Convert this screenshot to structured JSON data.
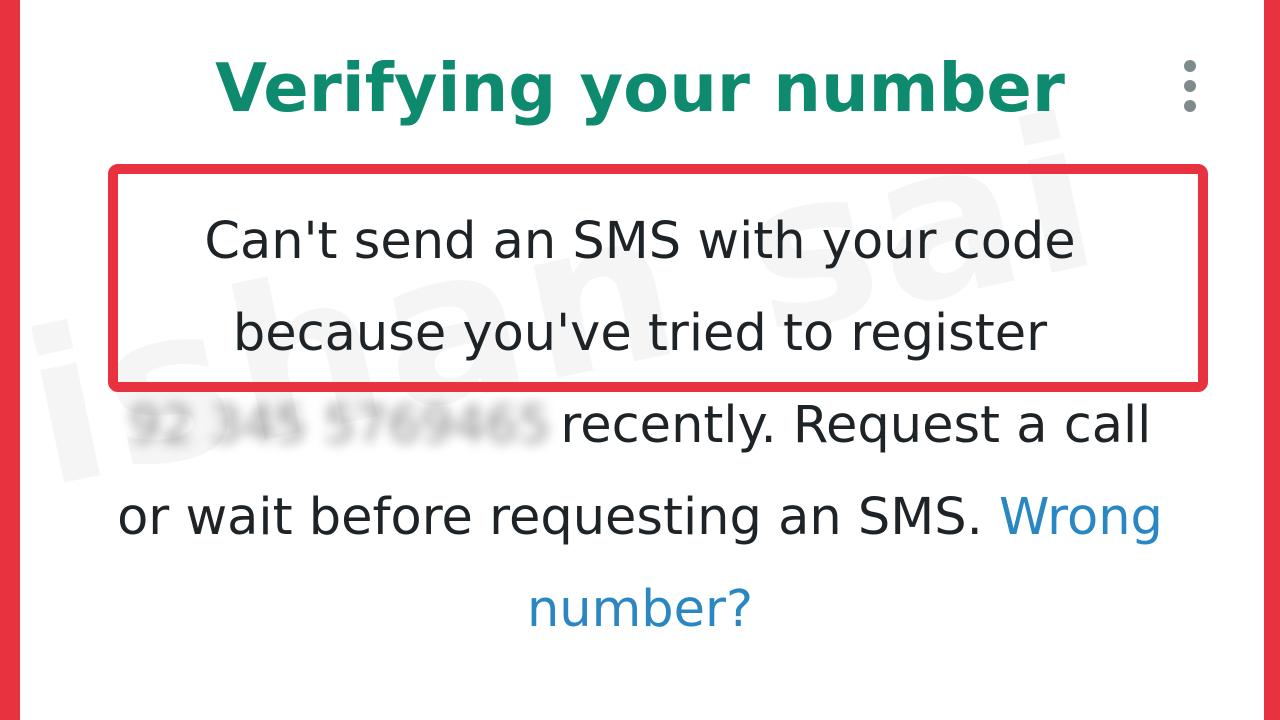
{
  "header": {
    "title": "Verifying your number",
    "menu_icon": "more-vert-icon"
  },
  "message": {
    "line1": "Can't send an SMS with your code",
    "line2": "because you've tried to register",
    "phone_number_blurred": "92 345 5769465",
    "line3_rest": "recently. Request a call",
    "line4_text": "or wait before requesting an SMS.",
    "wrong_link_part1": "Wrong",
    "wrong_link_part2": "number?"
  },
  "colors": {
    "title_green": "#0e8a6f",
    "frame_red": "#e8323f",
    "link_blue": "#2a87c2",
    "text_dark": "#1d2326"
  }
}
